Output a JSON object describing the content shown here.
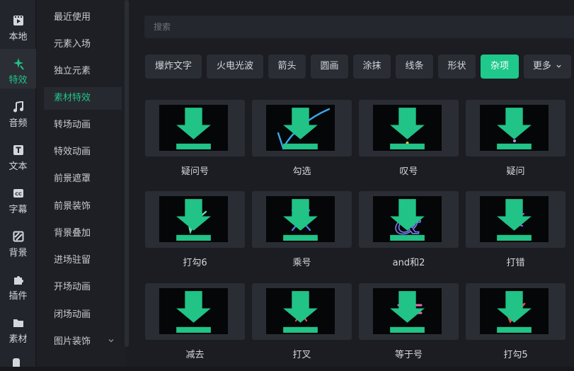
{
  "rail": {
    "items": [
      {
        "label": "本地",
        "icon": "film-icon"
      },
      {
        "label": "特效",
        "icon": "sparkle-icon"
      },
      {
        "label": "音频",
        "icon": "music-note-icon"
      },
      {
        "label": "文本",
        "icon": "text-t-icon"
      },
      {
        "label": "字幕",
        "icon": "caption-cc-icon"
      },
      {
        "label": "背景",
        "icon": "background-slash-icon"
      },
      {
        "label": "插件",
        "icon": "puzzle-icon"
      },
      {
        "label": "素材",
        "icon": "folder-icon"
      }
    ]
  },
  "categories": {
    "items": [
      "最近使用",
      "元素入场",
      "独立元素",
      "素材特效",
      "转场动画",
      "特效动画",
      "前景遮罩",
      "前景装饰",
      "背景叠加",
      "进场驻留",
      "开场动画",
      "闭场动画",
      "图片装饰"
    ],
    "expand_icon": "chevron-down-icon"
  },
  "search": {
    "placeholder": "搜索"
  },
  "tags": {
    "items": [
      "爆炸文字",
      "火电光波",
      "箭头",
      "圆画",
      "涂抹",
      "线条",
      "形状",
      "杂项",
      "更多"
    ],
    "active": "杂项"
  },
  "grid": {
    "items": [
      {
        "label": "疑问号"
      },
      {
        "label": "勾选"
      },
      {
        "label": "叹号"
      },
      {
        "label": "疑问"
      },
      {
        "label": "打勾6"
      },
      {
        "label": "乘号"
      },
      {
        "label": "and和2"
      },
      {
        "label": "打错"
      },
      {
        "label": "减去"
      },
      {
        "label": "打叉"
      },
      {
        "label": "等于号"
      },
      {
        "label": "打勾5"
      }
    ]
  },
  "colors": {
    "accent": "#1fc98c",
    "download": "#21c387"
  }
}
